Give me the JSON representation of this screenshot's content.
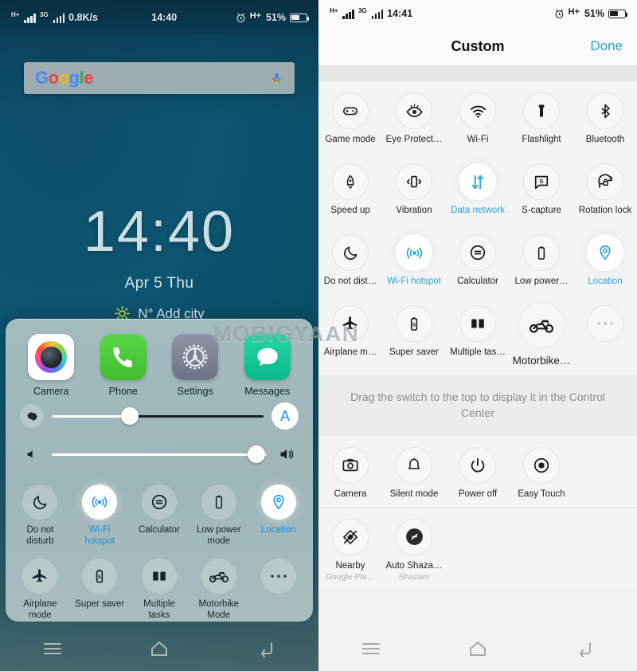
{
  "left": {
    "status": {
      "net1": "H+",
      "net2": "3G",
      "speed": "0.8K/s",
      "time": "14:40",
      "battery": "51%"
    },
    "search": {
      "logo": "Google",
      "mic_icon": "microphone-icon"
    },
    "lock": {
      "time": "14:40",
      "date": "Apr 5  Thu",
      "weather": "N° Add city"
    },
    "apps": [
      {
        "label": "Camera",
        "icon": "camera-app-icon"
      },
      {
        "label": "Phone",
        "icon": "phone-app-icon"
      },
      {
        "label": "Settings",
        "icon": "settings-app-icon"
      },
      {
        "label": "Messages",
        "icon": "messages-app-icon"
      }
    ],
    "brightness": {
      "icon": "brightness-gear-icon",
      "auto_label": "A",
      "value": 37
    },
    "volume": {
      "icon": "volume-mute-icon",
      "right_icon": "volume-up-icon",
      "value": 95
    },
    "toggles": [
      {
        "label": "Do not\ndisturb",
        "icon": "moon-icon",
        "on": false
      },
      {
        "label": "Wi-Fi\nhotspot",
        "icon": "hotspot-icon",
        "on": true
      },
      {
        "label": "Calculator",
        "icon": "calculator-icon",
        "on": false
      },
      {
        "label": "Low power\nmode",
        "icon": "battery-icon",
        "on": false
      },
      {
        "label": "Location",
        "icon": "location-pin-icon",
        "on": true
      },
      {
        "label": "Airplane\nmode",
        "icon": "airplane-icon",
        "on": false
      },
      {
        "label": "Super saver",
        "icon": "super-saver-icon",
        "on": false
      },
      {
        "label": "Multiple\ntasks",
        "icon": "split-screen-icon",
        "on": false
      },
      {
        "label": "Motorbike\nMode",
        "icon": "motorbike-icon",
        "on": false
      },
      {
        "label": "",
        "icon": "more-dots-icon",
        "on": false
      }
    ],
    "nav": {
      "menu": "menu-icon",
      "home": "home-icon",
      "back": "back-icon"
    }
  },
  "right": {
    "status": {
      "net1": "H+",
      "net2": "3G",
      "time": "14:41",
      "battery": "51%"
    },
    "header": {
      "title": "Custom",
      "done_label": "Done"
    },
    "active_tiles": [
      {
        "label": "Game mode",
        "icon": "gamepad-icon",
        "on": false
      },
      {
        "label": "Eye Protect…",
        "icon": "eye-icon",
        "on": false
      },
      {
        "label": "Wi-Fi",
        "icon": "wifi-icon",
        "on": false
      },
      {
        "label": "Flashlight",
        "icon": "flashlight-icon",
        "on": false
      },
      {
        "label": "Bluetooth",
        "icon": "bluetooth-icon",
        "on": false
      },
      {
        "label": "Speed up",
        "icon": "rocket-icon",
        "on": false
      },
      {
        "label": "Vibration",
        "icon": "vibration-icon",
        "on": false
      },
      {
        "label": "Data network",
        "icon": "data-network-icon",
        "on": true
      },
      {
        "label": "S-capture",
        "icon": "s-capture-icon",
        "on": false
      },
      {
        "label": "Rotation lock",
        "icon": "rotation-lock-icon",
        "on": false
      },
      {
        "label": "Do not dist…",
        "icon": "moon-icon",
        "on": false
      },
      {
        "label": "Wi-Fi hotspot",
        "icon": "hotspot-icon",
        "on": true
      },
      {
        "label": "Calculator",
        "icon": "calculator-icon",
        "on": false
      },
      {
        "label": "Low power…",
        "icon": "battery-icon",
        "on": false
      },
      {
        "label": "Location",
        "icon": "location-pin-icon",
        "on": true
      },
      {
        "label": "Airplane m…",
        "icon": "airplane-icon",
        "on": false
      },
      {
        "label": "Super saver",
        "icon": "super-saver-icon",
        "on": false
      },
      {
        "label": "Multiple tas…",
        "icon": "split-screen-icon",
        "on": false
      },
      {
        "label": "Motorbike…",
        "icon": "motorbike-icon",
        "on": false,
        "dragging": true
      },
      {
        "label": "",
        "icon": "more-dots-icon",
        "on": false
      }
    ],
    "hint": "Drag the switch to the top to display it in the Control Center",
    "inactive_tiles": [
      {
        "label": "Camera",
        "icon": "camera-icon",
        "sub": ""
      },
      {
        "label": "Silent mode",
        "icon": "bell-icon",
        "sub": ""
      },
      {
        "label": "Power off",
        "icon": "power-icon",
        "sub": ""
      },
      {
        "label": "Easy Touch",
        "icon": "easy-touch-icon",
        "sub": ""
      }
    ],
    "app_tiles": [
      {
        "label": "Nearby",
        "icon": "nearby-icon",
        "sub": "Google Pla…"
      },
      {
        "label": "Auto Shaza…",
        "icon": "shazam-icon",
        "sub": "Shazam"
      }
    ],
    "nav": {
      "menu": "menu-icon",
      "home": "home-icon",
      "back": "back-icon"
    }
  },
  "watermark": "MOBIGYAAN",
  "colors": {
    "accent": "#2aa3d6",
    "panel": "#f4f4f4",
    "wallpaper": "#0d5470"
  }
}
